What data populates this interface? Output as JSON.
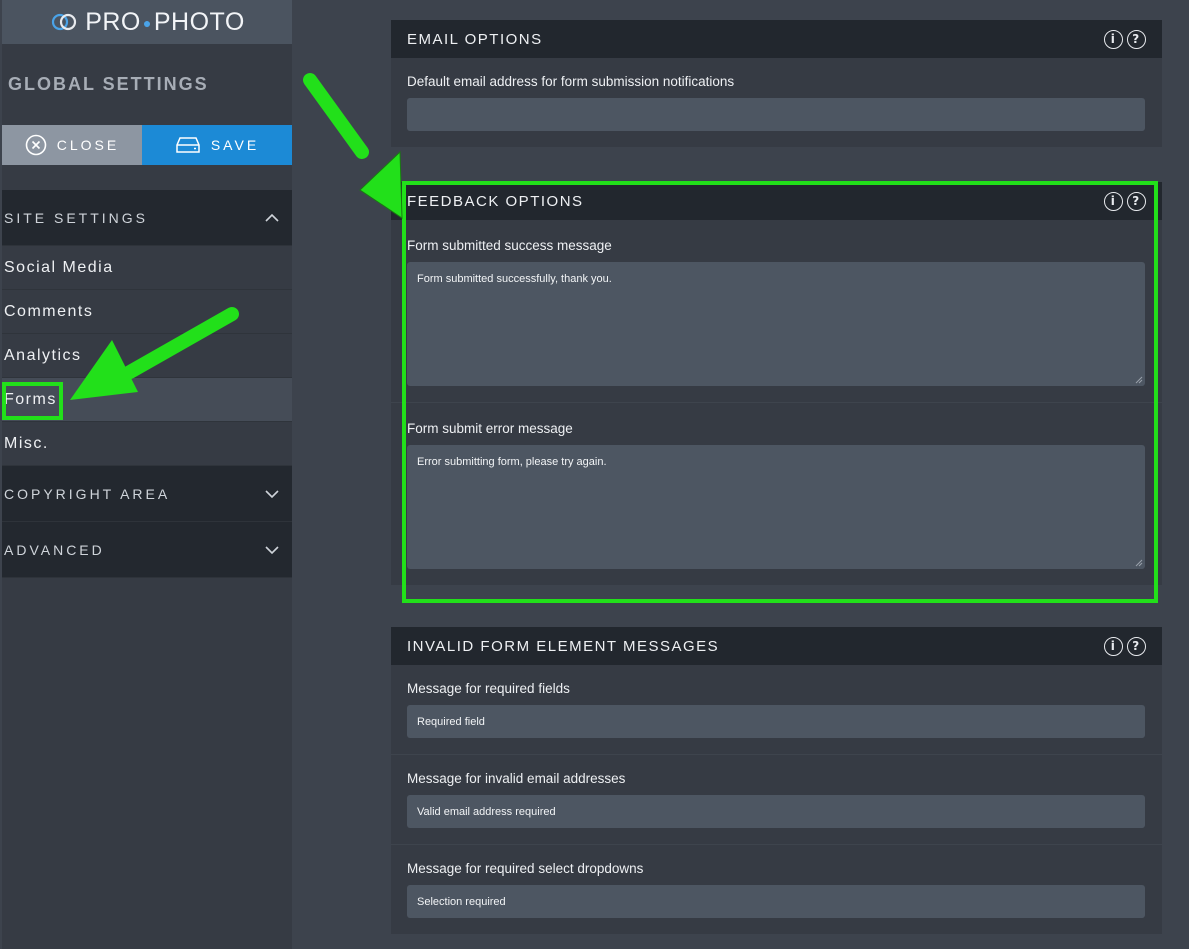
{
  "sidebar": {
    "logo_text": "PRO",
    "logo_text2": "PHOTO",
    "title": "GLOBAL SETTINGS",
    "close_label": "CLOSE",
    "save_label": "SAVE",
    "sections": {
      "site_settings": "SITE SETTINGS",
      "copyright": "COPYRIGHT AREA",
      "advanced": "ADVANCED"
    },
    "items": [
      "Social Media",
      "Comments",
      "Analytics",
      "Forms",
      "Misc."
    ]
  },
  "email_options": {
    "title": "EMAIL OPTIONS",
    "default_label": "Default email address for form submission notifications",
    "default_value": ""
  },
  "feedback_options": {
    "title": "FEEDBACK OPTIONS",
    "success_label": "Form submitted success message",
    "success_value": "Form submitted successfully, thank you.",
    "error_label": "Form submit error message",
    "error_value": "Error submitting form, please try again."
  },
  "invalid_messages": {
    "title": "INVALID FORM ELEMENT MESSAGES",
    "required_label": "Message for required fields",
    "required_value": "Required field",
    "email_label": "Message for invalid email addresses",
    "email_value": "Valid email address required",
    "select_label": "Message for required select dropdowns",
    "select_value": "Selection required"
  },
  "colors": {
    "accent": "#1c8ad6",
    "highlight": "#22e01a"
  },
  "icons": [
    "info-icon",
    "help-icon",
    "close-circle-icon",
    "drive-icon",
    "chevron-up-icon",
    "chevron-down-icon"
  ]
}
